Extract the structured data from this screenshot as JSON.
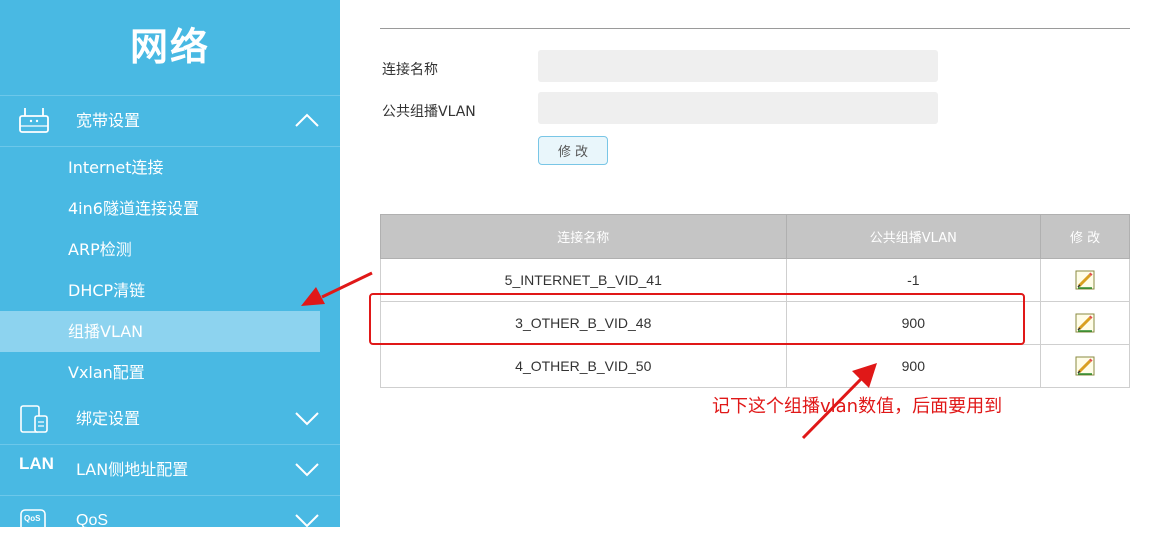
{
  "sidebar": {
    "title": "网络",
    "sections": [
      {
        "label": "宽带设置",
        "icon": "router-icon",
        "expanded": true
      },
      {
        "label": "绑定设置",
        "icon": "devices-icon",
        "expanded": false
      },
      {
        "label": "LAN侧地址配置",
        "icon": "lan-icon",
        "icon_text": "LAN",
        "expanded": false
      },
      {
        "label": "QoS",
        "icon": "qos-icon",
        "icon_text": "QoS",
        "expanded": false
      }
    ],
    "submenu": [
      {
        "label": "Internet连接"
      },
      {
        "label": "4in6隧道连接设置"
      },
      {
        "label": "ARP检测"
      },
      {
        "label": "DHCP清链"
      },
      {
        "label": "组播VLAN",
        "active": true
      },
      {
        "label": "Vxlan配置"
      }
    ]
  },
  "form": {
    "connection_name_label": "连接名称",
    "connection_name_value": "",
    "public_vlan_label": "公共组播VLAN",
    "public_vlan_value": "",
    "modify_button": "修改"
  },
  "table": {
    "headers": [
      "连接名称",
      "公共组播VLAN",
      "修 改"
    ],
    "rows": [
      {
        "name": "5_INTERNET_B_VID_41",
        "vlan": "-1"
      },
      {
        "name": "3_OTHER_B_VID_48",
        "vlan": "900"
      },
      {
        "name": "4_OTHER_B_VID_50",
        "vlan": "900"
      }
    ]
  },
  "annotation": {
    "text": "记下这个组播vlan数值，后面要用到",
    "color": "#e01818"
  },
  "colors": {
    "sidebar_bg": "#49b9e3",
    "sidebar_active": "#8dd3ef",
    "table_header": "#c5c5c5",
    "annotation_red": "#e01818"
  }
}
